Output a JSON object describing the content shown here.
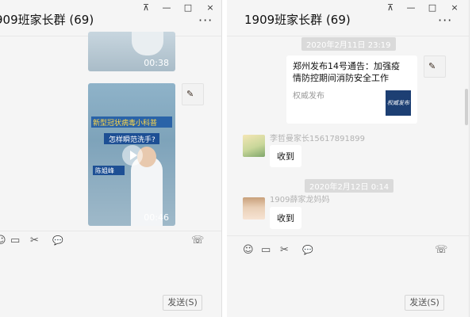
{
  "left_window": {
    "title": "909班家长群 (69)",
    "controls": {
      "pin": "⊼",
      "minimize": "—",
      "maximize": "□",
      "close": "×"
    },
    "more": "···",
    "messages": [
      {
        "type": "video",
        "duration": "00:38"
      },
      {
        "type": "video",
        "duration": "00:46",
        "banner_text": "新型冠状病毒小科普",
        "subtitle": "怎样瞬范洗手?",
        "name_tag": "陈姐峰"
      }
    ],
    "toolbar": {
      "emoji": "☺",
      "folder": "▭",
      "scissors": "✂",
      "chat": "💬",
      "call": "☏"
    },
    "send_label": "发送(S)"
  },
  "right_window": {
    "title": "1909班家长群 (69)",
    "controls": {
      "pin": "⊼",
      "minimize": "—",
      "maximize": "□",
      "close": "×"
    },
    "more": "···",
    "messages": [
      {
        "type": "timestamp",
        "text": "2020年2月11日 23:19"
      },
      {
        "type": "card",
        "title": "郑州发布14号通告：加强疫情防控期间消防安全工作",
        "source": "权威发布",
        "thumb_text": "权威发布"
      },
      {
        "type": "text",
        "sender": "李哲曼家长15617891899",
        "text": "收到"
      },
      {
        "type": "timestamp",
        "text": "2020年2月12日 0:14"
      },
      {
        "type": "text",
        "sender": "1909薛家龙妈妈",
        "text": "收到"
      }
    ],
    "toolbar": {
      "emoji": "☺",
      "folder": "▭",
      "scissors": "✂",
      "chat": "💬",
      "call": "☏"
    },
    "send_label": "发送(S)"
  },
  "colors": {
    "window_bg": "#f5f5f5",
    "bubble_bg": "#ffffff",
    "timestamp_bg": "#dadada",
    "card_thumb": "#1d3f73"
  }
}
